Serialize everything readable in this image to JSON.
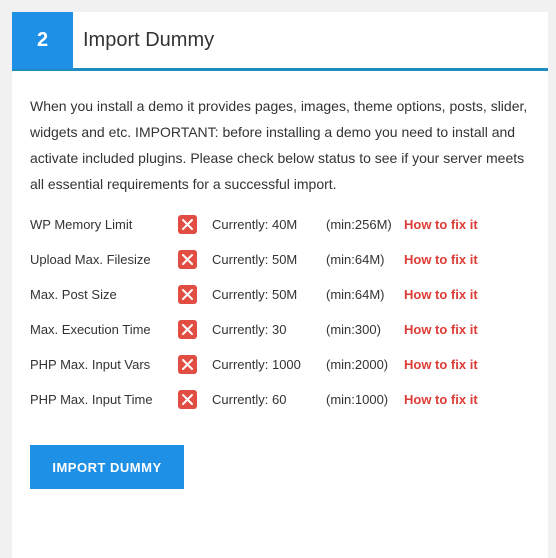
{
  "header": {
    "step_number": "2",
    "title": "Import Dummy"
  },
  "intro_text": "When you install a demo it provides pages, images, theme options, posts, slider, widgets and etc. IMPORTANT: before installing a demo you need to install and activate included plugins. Please check below status to see if your server meets all essential requirements for a successful import.",
  "requirements": [
    {
      "label": "WP Memory Limit",
      "current": "Currently: 40M",
      "min": "(min:256M)",
      "fix": "How to fix it"
    },
    {
      "label": "Upload Max. Filesize",
      "current": "Currently: 50M",
      "min": "(min:64M)",
      "fix": "How to fix it"
    },
    {
      "label": "Max. Post Size",
      "current": "Currently: 50M",
      "min": "(min:64M)",
      "fix": "How to fix it"
    },
    {
      "label": "Max. Execution Time",
      "current": "Currently: 30",
      "min": "(min:300)",
      "fix": "How to fix it"
    },
    {
      "label": "PHP Max. Input Vars",
      "current": "Currently: 1000",
      "min": "(min:2000)",
      "fix": "How to fix it"
    },
    {
      "label": "PHP Max. Input Time",
      "current": "Currently: 60",
      "min": "(min:1000)",
      "fix": "How to fix it"
    }
  ],
  "status_icon": "close-icon",
  "colors": {
    "accent": "#1e90e6",
    "error": "#e14d43",
    "fix_link": "#dd3d36"
  },
  "import_button_label": "IMPORT DUMMY"
}
